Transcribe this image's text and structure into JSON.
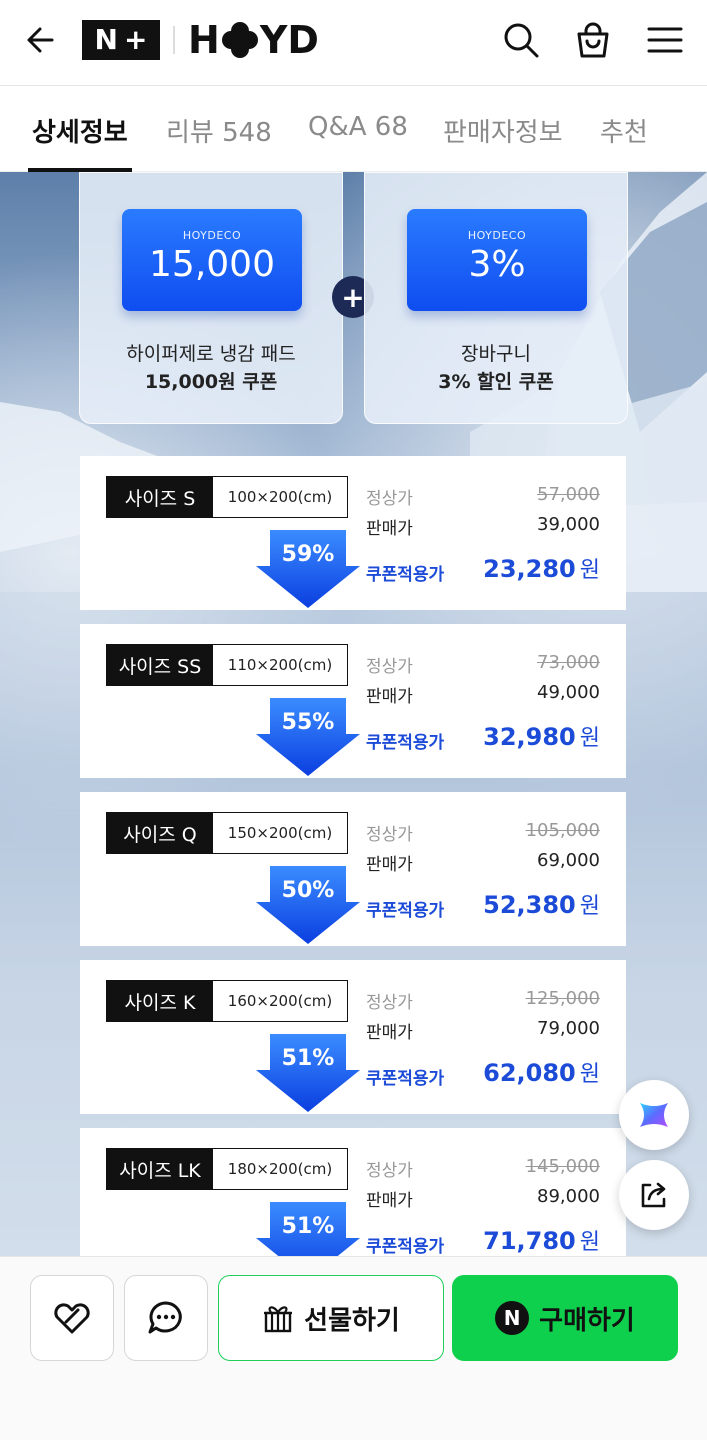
{
  "header": {
    "nplus_left": "N",
    "nplus_right": "+",
    "brand_left": "H",
    "brand_right": "YD"
  },
  "tabs": [
    {
      "label": "상세정보",
      "active": true
    },
    {
      "label": "리뷰 548",
      "active": false
    },
    {
      "label": "Q&A 68",
      "active": false
    },
    {
      "label": "판매자정보",
      "active": false
    },
    {
      "label": "추천",
      "active": false
    }
  ],
  "coupons": [
    {
      "brand": "HOYDECO",
      "amount": "15,000",
      "desc1": "하이퍼제로 냉감 패드",
      "desc2": "15,000원 쿠폰"
    },
    {
      "brand": "HOYDECO",
      "amount": "3%",
      "desc1": "장바구니",
      "desc2": "3% 할인 쿠폰"
    }
  ],
  "plus_sign": "+",
  "price_labels": {
    "regular": "정상가",
    "sale": "판매가",
    "coupon": "쿠폰적용가",
    "won": "원"
  },
  "sizes": [
    {
      "name": "사이즈 S",
      "dim": "100×200(cm)",
      "pct": "59%",
      "regular": "57,000",
      "sale": "39,000",
      "coupon": "23,280"
    },
    {
      "name": "사이즈 SS",
      "dim": "110×200(cm)",
      "pct": "55%",
      "regular": "73,000",
      "sale": "49,000",
      "coupon": "32,980"
    },
    {
      "name": "사이즈 Q",
      "dim": "150×200(cm)",
      "pct": "50%",
      "regular": "105,000",
      "sale": "69,000",
      "coupon": "52,380"
    },
    {
      "name": "사이즈 K",
      "dim": "160×200(cm)",
      "pct": "51%",
      "regular": "125,000",
      "sale": "79,000",
      "coupon": "62,080"
    },
    {
      "name": "사이즈 LK",
      "dim": "180×200(cm)",
      "pct": "51%",
      "regular": "145,000",
      "sale": "89,000",
      "coupon": "71,780"
    }
  ],
  "bottom_bar": {
    "gift_label": "선물하기",
    "buy_label": "구매하기",
    "npay_letter": "N"
  },
  "colors": {
    "accent_blue": "#1c4bd8",
    "buy_green": "#0fd04d",
    "ticket_blue": "#1a5cf5"
  }
}
